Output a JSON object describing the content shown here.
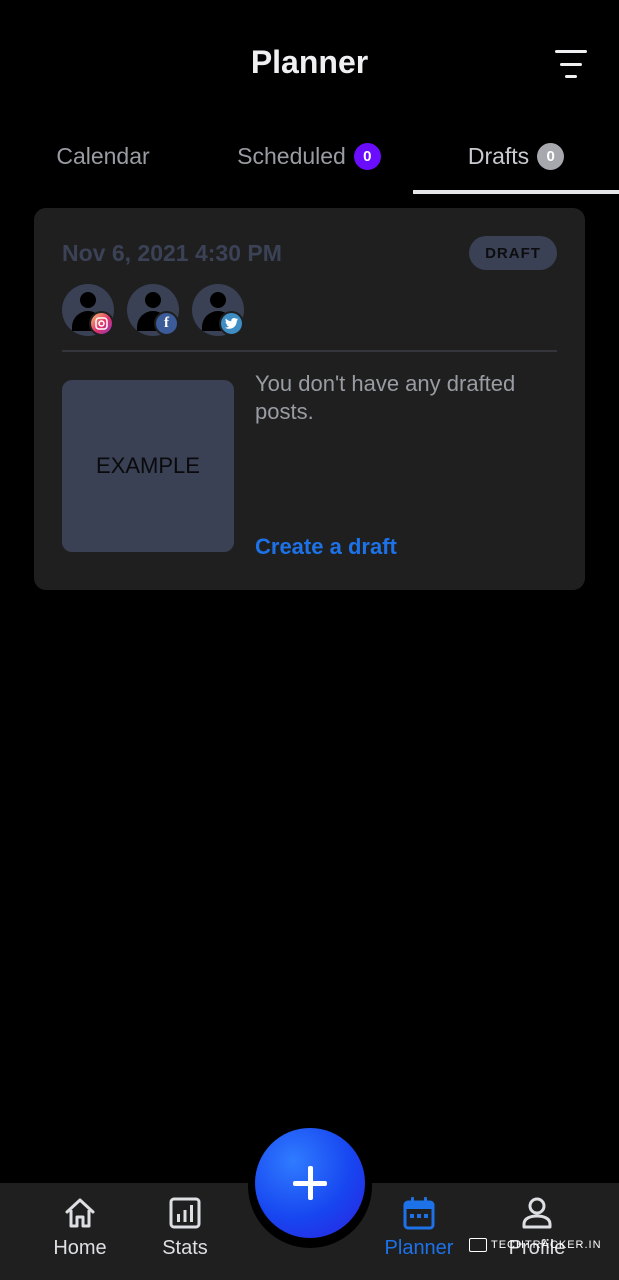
{
  "header": {
    "title": "Planner",
    "filter_icon": "filter-icon"
  },
  "tabs": [
    {
      "label": "Calendar",
      "active": false
    },
    {
      "label": "Scheduled",
      "badge": "0",
      "badge_color": "#6a0dff",
      "active": false
    },
    {
      "label": "Drafts",
      "badge": "0",
      "badge_color": "#a6a8ae",
      "active": true
    }
  ],
  "card": {
    "date": "Nov 6, 2021 4:30 PM",
    "status_badge": "DRAFT",
    "accounts": [
      {
        "network": "instagram",
        "icon": "instagram-icon"
      },
      {
        "network": "facebook",
        "icon": "facebook-icon",
        "glyph": "f"
      },
      {
        "network": "twitter",
        "icon": "twitter-icon"
      }
    ],
    "preview_label": "EXAMPLE",
    "empty_message": "You don't have any drafted posts.",
    "create_link": "Create a draft"
  },
  "fab": {
    "icon": "plus-icon"
  },
  "bottom_nav": [
    {
      "label": "Home",
      "icon": "home-icon",
      "active": false
    },
    {
      "label": "Stats",
      "icon": "stats-icon",
      "active": false
    },
    {
      "label": "Planner",
      "icon": "calendar-icon",
      "active": true
    },
    {
      "label": "Profile",
      "icon": "profile-icon",
      "active": false
    }
  ],
  "watermark": "TECHTRACKER.IN",
  "colors": {
    "background": "#000000",
    "card": "#1f1f20",
    "accent_blue": "#1d72e8",
    "badge_slate": "#3a4155"
  }
}
